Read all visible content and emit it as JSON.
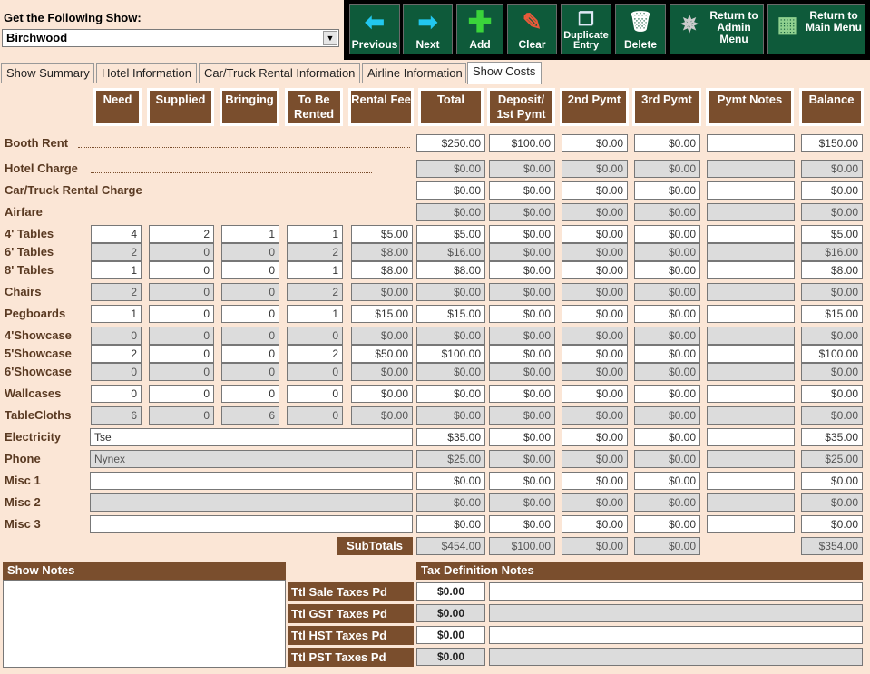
{
  "show_picker": {
    "label": "Get the Following Show:",
    "value": "Birchwood"
  },
  "toolbar": {
    "previous": "Previous",
    "next": "Next",
    "add": "Add",
    "clear": "Clear",
    "duplicate": "Duplicate Entry",
    "delete": "Delete",
    "admin": "Return to Admin Menu",
    "main": "Return to Main Menu"
  },
  "tabs": [
    "Show Summary",
    "Hotel Information",
    "Car/Truck Rental Information",
    "Airline Information",
    "Show Costs"
  ],
  "columns": {
    "need": "Need",
    "supplied": "Supplied",
    "bringing": "Bringing",
    "to_be_rented": "To Be Rented",
    "rental_fee": "Rental Fee",
    "total": "Total",
    "deposit": "Deposit/ 1st Pymt",
    "pymt2": "2nd Pymt",
    "pymt3": "3rd Pymt",
    "pymt_notes": "Pymt Notes",
    "balance": "Balance"
  },
  "rows": {
    "booth_rent": {
      "label": "Booth Rent",
      "total": "$250.00",
      "deposit": "$100.00",
      "pymt2": "$0.00",
      "pymt3": "$0.00",
      "notes": "",
      "balance": "$150.00"
    },
    "hotel": {
      "label": "Hotel Charge",
      "total": "$0.00",
      "deposit": "$0.00",
      "pymt2": "$0.00",
      "pymt3": "$0.00",
      "notes": "",
      "balance": "$0.00"
    },
    "car": {
      "label": "Car/Truck Rental Charge",
      "total": "$0.00",
      "deposit": "$0.00",
      "pymt2": "$0.00",
      "pymt3": "$0.00",
      "notes": "",
      "balance": "$0.00"
    },
    "airfare": {
      "label": "Airfare",
      "total": "$0.00",
      "deposit": "$0.00",
      "pymt2": "$0.00",
      "pymt3": "$0.00",
      "notes": "",
      "balance": "$0.00"
    },
    "tables4": {
      "label": "4' Tables",
      "need": "4",
      "supplied": "2",
      "bringing": "1",
      "rented": "1",
      "fee": "$5.00",
      "total": "$5.00",
      "deposit": "$0.00",
      "pymt2": "$0.00",
      "pymt3": "$0.00",
      "notes": "",
      "balance": "$5.00"
    },
    "tables6": {
      "label": "6' Tables",
      "need": "2",
      "supplied": "0",
      "bringing": "0",
      "rented": "2",
      "fee": "$8.00",
      "total": "$16.00",
      "deposit": "$0.00",
      "pymt2": "$0.00",
      "pymt3": "$0.00",
      "notes": "",
      "balance": "$16.00"
    },
    "tables8": {
      "label": "8' Tables",
      "need": "1",
      "supplied": "0",
      "bringing": "0",
      "rented": "1",
      "fee": "$8.00",
      "total": "$8.00",
      "deposit": "$0.00",
      "pymt2": "$0.00",
      "pymt3": "$0.00",
      "notes": "",
      "balance": "$8.00"
    },
    "chairs": {
      "label": "Chairs",
      "need": "2",
      "supplied": "0",
      "bringing": "0",
      "rented": "2",
      "fee": "$0.00",
      "total": "$0.00",
      "deposit": "$0.00",
      "pymt2": "$0.00",
      "pymt3": "$0.00",
      "notes": "",
      "balance": "$0.00"
    },
    "pegboards": {
      "label": "Pegboards",
      "need": "1",
      "supplied": "0",
      "bringing": "0",
      "rented": "1",
      "fee": "$15.00",
      "total": "$15.00",
      "deposit": "$0.00",
      "pymt2": "$0.00",
      "pymt3": "$0.00",
      "notes": "",
      "balance": "$15.00"
    },
    "showcase4": {
      "label": "4'Showcase",
      "need": "0",
      "supplied": "0",
      "bringing": "0",
      "rented": "0",
      "fee": "$0.00",
      "total": "$0.00",
      "deposit": "$0.00",
      "pymt2": "$0.00",
      "pymt3": "$0.00",
      "notes": "",
      "balance": "$0.00"
    },
    "showcase5": {
      "label": "5'Showcase",
      "need": "2",
      "supplied": "0",
      "bringing": "0",
      "rented": "2",
      "fee": "$50.00",
      "total": "$100.00",
      "deposit": "$0.00",
      "pymt2": "$0.00",
      "pymt3": "$0.00",
      "notes": "",
      "balance": "$100.00"
    },
    "showcase6": {
      "label": "6'Showcase",
      "need": "0",
      "supplied": "0",
      "bringing": "0",
      "rented": "0",
      "fee": "$0.00",
      "total": "$0.00",
      "deposit": "$0.00",
      "pymt2": "$0.00",
      "pymt3": "$0.00",
      "notes": "",
      "balance": "$0.00"
    },
    "wallcases": {
      "label": "Wallcases",
      "need": "0",
      "supplied": "0",
      "bringing": "0",
      "rented": "0",
      "fee": "$0.00",
      "total": "$0.00",
      "deposit": "$0.00",
      "pymt2": "$0.00",
      "pymt3": "$0.00",
      "notes": "",
      "balance": "$0.00"
    },
    "tablecloths": {
      "label": "TableCloths",
      "need": "6",
      "supplied": "0",
      "bringing": "6",
      "rented": "0",
      "fee": "$0.00",
      "total": "$0.00",
      "deposit": "$0.00",
      "pymt2": "$0.00",
      "pymt3": "$0.00",
      "notes": "",
      "balance": "$0.00"
    },
    "electricity": {
      "label": "Electricity",
      "desc": "Tse",
      "total": "$35.00",
      "deposit": "$0.00",
      "pymt2": "$0.00",
      "pymt3": "$0.00",
      "notes": "",
      "balance": "$35.00"
    },
    "phone": {
      "label": "Phone",
      "desc": "Nynex",
      "total": "$25.00",
      "deposit": "$0.00",
      "pymt2": "$0.00",
      "pymt3": "$0.00",
      "notes": "",
      "balance": "$25.00"
    },
    "misc1": {
      "label": "Misc 1",
      "desc": "",
      "total": "$0.00",
      "deposit": "$0.00",
      "pymt2": "$0.00",
      "pymt3": "$0.00",
      "notes": "",
      "balance": "$0.00"
    },
    "misc2": {
      "label": "Misc 2",
      "desc": "",
      "total": "$0.00",
      "deposit": "$0.00",
      "pymt2": "$0.00",
      "pymt3": "$0.00",
      "notes": "",
      "balance": "$0.00"
    },
    "misc3": {
      "label": "Misc 3",
      "desc": "",
      "total": "$0.00",
      "deposit": "$0.00",
      "pymt2": "$0.00",
      "pymt3": "$0.00",
      "notes": "",
      "balance": "$0.00"
    }
  },
  "subtotals": {
    "label": "SubTotals",
    "total": "$454.00",
    "deposit": "$100.00",
    "pymt2": "$0.00",
    "pymt3": "$0.00",
    "balance": "$354.00"
  },
  "show_notes": {
    "label": "Show Notes",
    "value": ""
  },
  "tax_notes_label": "Tax Definition Notes",
  "taxes": [
    {
      "label": "Ttl Sale Taxes Pd",
      "value": "$0.00",
      "note": ""
    },
    {
      "label": "Ttl GST Taxes Pd",
      "value": "$0.00",
      "note": ""
    },
    {
      "label": "Ttl HST Taxes Pd",
      "value": "$0.00",
      "note": ""
    },
    {
      "label": "Ttl PST Taxes Pd",
      "value": "$0.00",
      "note": ""
    }
  ]
}
